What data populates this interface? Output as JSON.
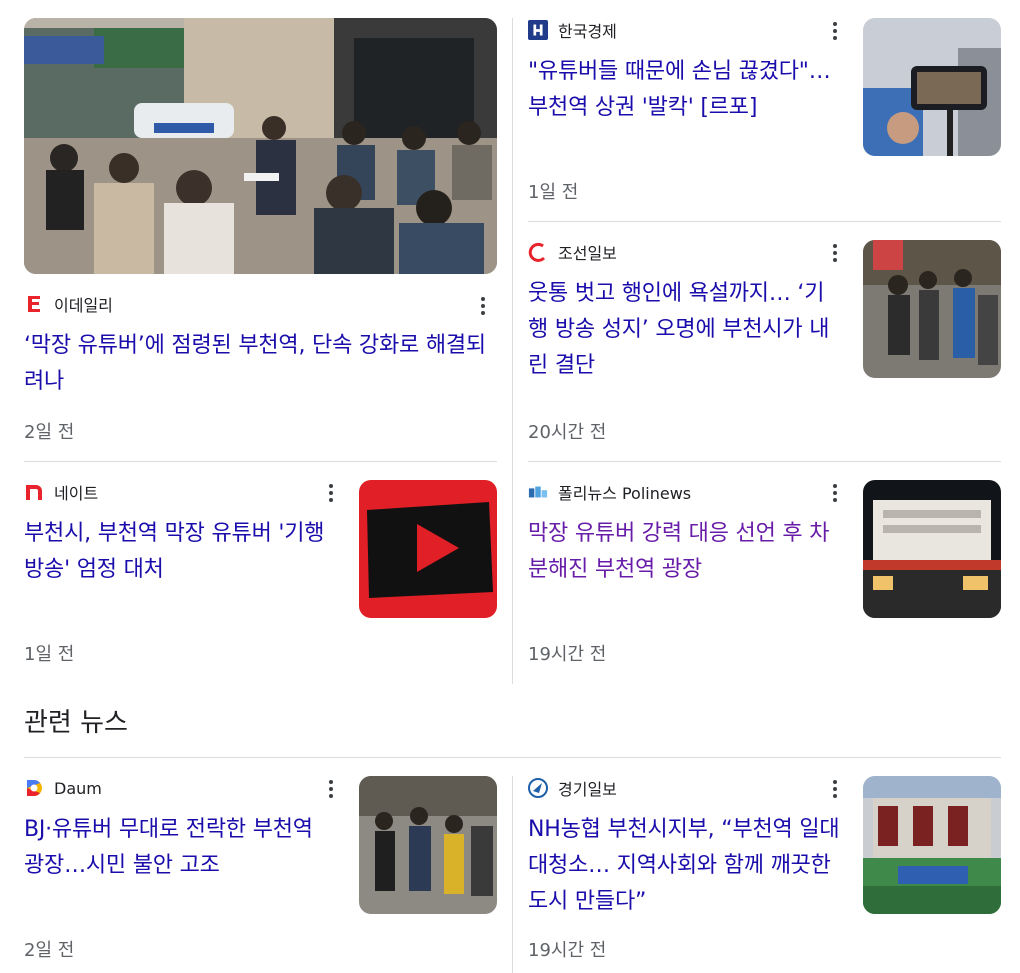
{
  "top_stories": [
    {
      "source": "이데일리",
      "logo_icon": "edaily-logo-icon",
      "logo_color": "#e8232b",
      "headline": "‘막장 유튜버’에 점령된 부천역, 단속 강화로 해결되려나",
      "time": "2일 전",
      "visited": false,
      "image": "town-hall-meeting-photo"
    },
    {
      "source": "한국경제",
      "logo_icon": "hankyung-logo-icon",
      "logo_color": "#1f3b8a",
      "headline": "\"유튜버들 때문에 손님 끊겼다\"…부천역 상권 '발칵' [르포]",
      "time": "1일 전",
      "visited": false,
      "image": "phone-camera-stream-photo"
    },
    {
      "source": "조선일보",
      "logo_icon": "chosun-logo-icon",
      "logo_color": "#e8232b",
      "headline": "웃통 벗고 행인에 욕설까지… ‘기행 방송 성지’ 오명에 부천시가 내린 결단",
      "time": "20시간 전",
      "visited": false,
      "image": "street-crowd-photo"
    },
    {
      "source": "네이트",
      "logo_icon": "nate-logo-icon",
      "logo_color": "#e8232b",
      "headline": "부천시, 부천역 막장 유튜버 '기행 방송' 엄정 대처",
      "time": "1일 전",
      "visited": false,
      "image": "youtube-play-logo-image"
    },
    {
      "source": "폴리뉴스 Polinews",
      "logo_icon": "polinews-logo-icon",
      "logo_color": "#2b6cb0",
      "headline": "막장 유튜버 강력 대응 선언 후 차분해진 부천역 광장",
      "time": "19시간 전",
      "visited": true,
      "image": "station-night-photo"
    }
  ],
  "related_news": {
    "title": "관련 뉴스",
    "items": [
      {
        "source": "Daum",
        "logo_icon": "daum-logo-icon",
        "logo_color": "#4a7bf7",
        "headline": "BJ·유튜버 무대로 전락한 부천역 광장…시민 불안 고조",
        "time": "2일 전",
        "visited": false,
        "image": "plaza-crowd-photo"
      },
      {
        "source": "경기일보",
        "logo_icon": "kyeonggi-ilbo-logo-icon",
        "logo_color": "#1d5fa8",
        "headline": "NH농협 부천시지부, “부천역 일대 대청소… 지역사회와 함께 깨끗한 도시 만들다”",
        "time": "19시간 전",
        "visited": false,
        "image": "cleanup-volunteers-photo"
      }
    ]
  },
  "menu_icon": "more-vert-icon"
}
